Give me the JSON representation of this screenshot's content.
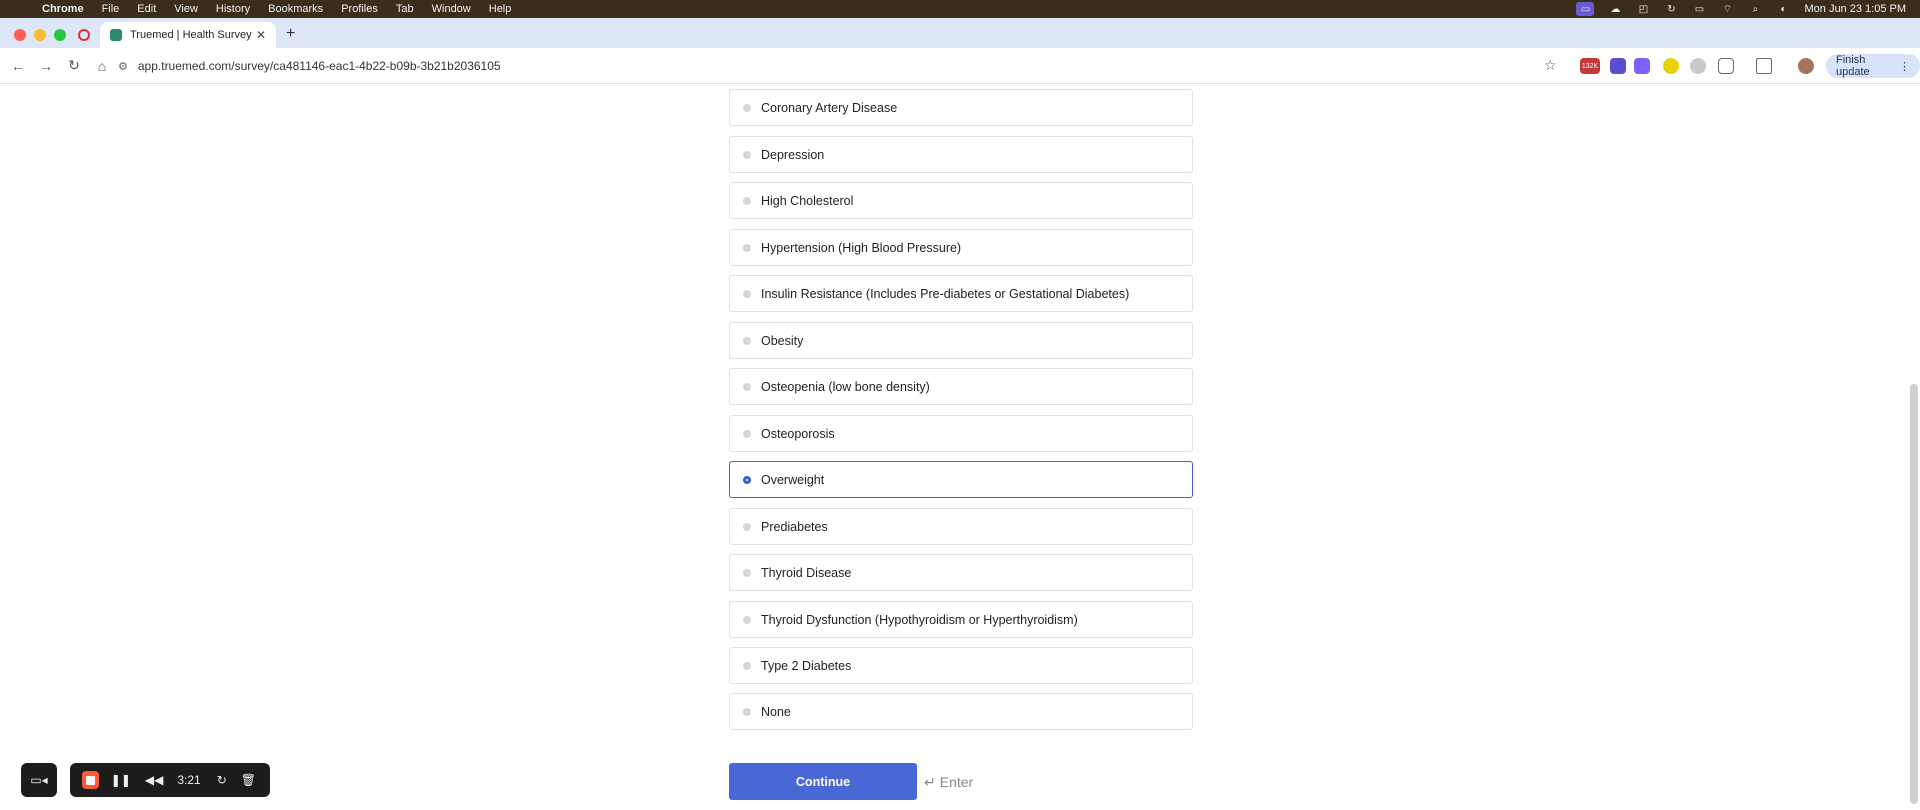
{
  "menubar": {
    "app": "Chrome",
    "items": [
      "File",
      "Edit",
      "View",
      "History",
      "Bookmarks",
      "Profiles",
      "Tab",
      "Window",
      "Help"
    ],
    "clock": "Mon Jun 23  1:05 PM"
  },
  "browser": {
    "tab_title": "Truemed | Health Survey",
    "url": "app.truemed.com/survey/ca481146-eac1-4b22-b09b-3b21b2036105",
    "finish_update": "Finish update",
    "ext_badge": "132K"
  },
  "survey": {
    "options": [
      {
        "label": "Coronary Artery Disease",
        "selected": false
      },
      {
        "label": "Depression",
        "selected": false
      },
      {
        "label": "High Cholesterol",
        "selected": false
      },
      {
        "label": "Hypertension (High Blood Pressure)",
        "selected": false
      },
      {
        "label": "Insulin Resistance (Includes Pre-diabetes or Gestational Diabetes)",
        "selected": false
      },
      {
        "label": "Obesity",
        "selected": false
      },
      {
        "label": "Osteopenia (low bone density)",
        "selected": false
      },
      {
        "label": "Osteoporosis",
        "selected": false
      },
      {
        "label": "Overweight",
        "selected": true
      },
      {
        "label": "Prediabetes",
        "selected": false
      },
      {
        "label": "Thyroid Disease",
        "selected": false
      },
      {
        "label": "Thyroid Dysfunction (Hypothyroidism or Hyperthyroidism)",
        "selected": false
      },
      {
        "label": "Type 2 Diabetes",
        "selected": false
      },
      {
        "label": "None",
        "selected": false
      }
    ],
    "continue_label": "Continue",
    "enter_hint": "Enter"
  },
  "recorder": {
    "time": "3:21"
  },
  "colors": {
    "accent": "#4a67d6",
    "selected_border": "#4a5fc1",
    "record": "#ff5a36"
  }
}
